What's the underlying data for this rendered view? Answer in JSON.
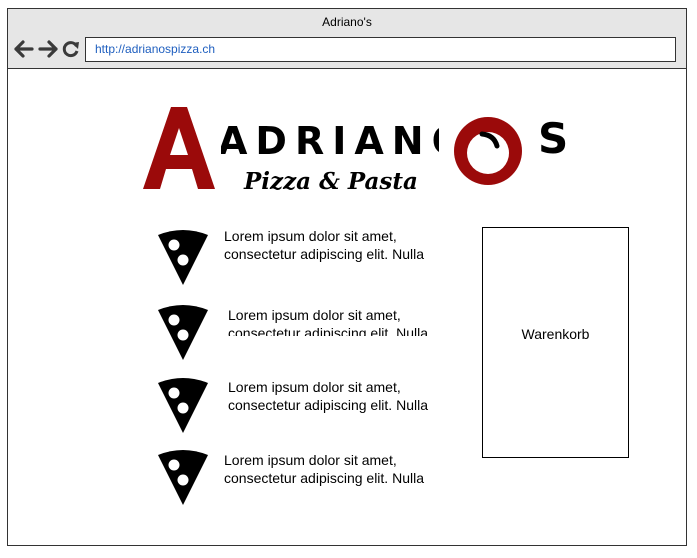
{
  "window": {
    "title": "Adriano's"
  },
  "navigation": {
    "url": "http://adrianospizza.ch"
  },
  "logo": {
    "main_text": "ADRIANOS",
    "tagline": "Pizza & Pasta"
  },
  "menu": {
    "items": [
      {
        "text": "Lorem ipsum dolor sit amet, consectetur adipiscing elit. Nulla"
      },
      {
        "text": "Lorem ipsum dolor sit amet, consectetur adipiscing elit. Nulla"
      },
      {
        "text": "Lorem ipsum dolor sit amet, consectetur adipiscing elit. Nulla"
      },
      {
        "text": "Lorem ipsum dolor sit amet, consectetur adipiscing elit. Nulla"
      }
    ]
  },
  "cart": {
    "label": "Warenkorb"
  },
  "colors": {
    "brand_red": "#9b0a0a",
    "chrome_gray": "#e6e6e6",
    "url_blue": "#1f5fbf"
  }
}
